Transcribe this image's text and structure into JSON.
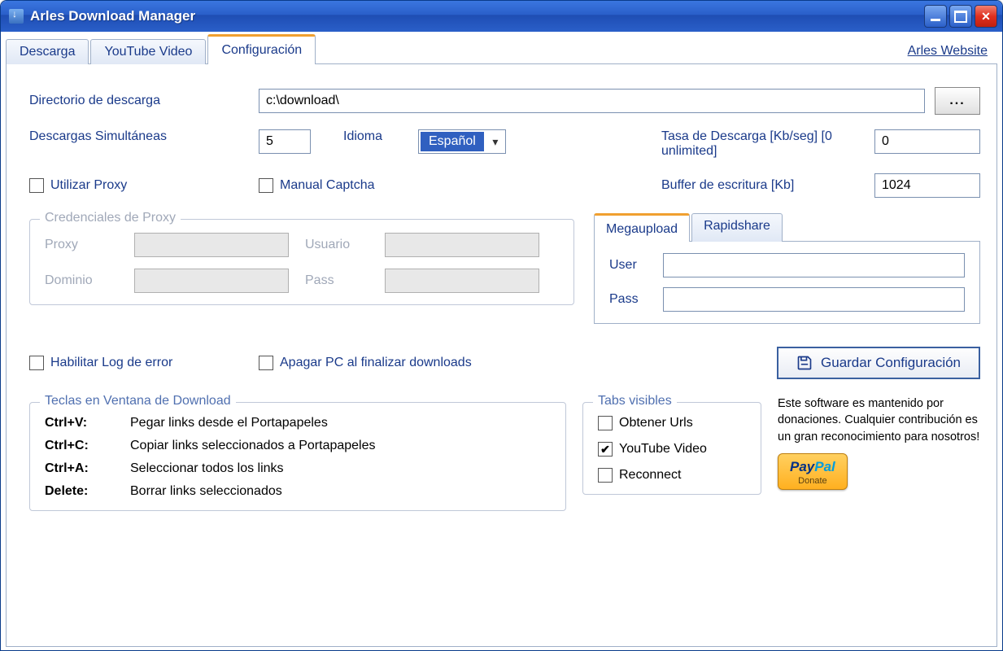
{
  "window": {
    "title": "Arles Download Manager"
  },
  "tabs": {
    "download": "Descarga",
    "youtube": "YouTube Video",
    "config": "Configuración",
    "website_link": "Arles Website"
  },
  "config": {
    "dir_label": "Directorio de descarga",
    "dir_value": "c:\\download\\",
    "browse_label": "...",
    "simultaneous_label": "Descargas Simultáneas",
    "simultaneous_value": "5",
    "language_label": "Idioma",
    "language_value": "Español",
    "rate_label": "Tasa de Descarga [Kb/seg] [0 unlimited]",
    "rate_value": "0",
    "buffer_label": "Buffer de escritura [Kb]",
    "buffer_value": "1024",
    "use_proxy_label": "Utilizar Proxy",
    "manual_captcha_label": "Manual Captcha",
    "proxy_group": {
      "legend": "Credenciales de Proxy",
      "proxy_label": "Proxy",
      "domain_label": "Dominio",
      "user_label": "Usuario",
      "pass_label": "Pass"
    },
    "upload_tabs": {
      "megaupload": "Megaupload",
      "rapidshare": "Rapidshare"
    },
    "cred": {
      "user_label": "User",
      "pass_label": "Pass"
    },
    "enable_log_label": "Habilitar Log de error",
    "shutdown_label": "Apagar PC al finalizar downloads",
    "save_button": "Guardar Configuración"
  },
  "shortcuts": {
    "legend": "Teclas en Ventana de Download",
    "items": [
      {
        "key": "Ctrl+V:",
        "desc": "Pegar links desde el Portapapeles"
      },
      {
        "key": "Ctrl+C:",
        "desc": "Copiar links seleccionados a Portapapeles"
      },
      {
        "key": "Ctrl+A:",
        "desc": "Seleccionar todos los links"
      },
      {
        "key": "Delete:",
        "desc": "Borrar links seleccionados"
      }
    ]
  },
  "tabs_visible": {
    "legend": "Tabs visibles",
    "obtain_urls": "Obtener Urls",
    "youtube_video": "YouTube Video",
    "reconnect": "Reconnect"
  },
  "donate": {
    "text": "Este software es mantenido por donaciones. Cualquier contribución es un gran reconocimiento para nosotros!",
    "paypal": "PayPal",
    "donate_label": "Donate"
  }
}
